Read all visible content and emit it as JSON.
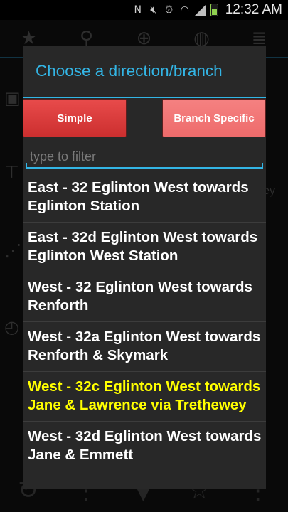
{
  "status_bar": {
    "time": "12:32 AM",
    "icons": [
      "nfc-icon",
      "mute-icon",
      "alarm-icon",
      "wifi-icon",
      "signal-icon",
      "battery-icon"
    ]
  },
  "background": {
    "tabs": [
      "star-icon",
      "search-icon",
      "location-icon",
      "globe-icon",
      "list-icon"
    ],
    "side_icons": [
      "bus-icon",
      "stop-sign-icon",
      "route-icon",
      "clock-icon"
    ],
    "partial_text": "ey",
    "bottom_icons": [
      "refresh-icon",
      "more-vertical-icon",
      "arrow-down-icon",
      "star-outline-icon",
      "overflow-icon"
    ]
  },
  "dialog": {
    "title": "Choose a direction/branch",
    "buttons": {
      "simple": "Simple",
      "branch_specific": "Branch Specific"
    },
    "filter": {
      "placeholder": "type to filter",
      "value": ""
    },
    "items": [
      {
        "label": "East - 32 Eglinton West towards Eglinton Station",
        "highlighted": false
      },
      {
        "label": "East - 32d Eglinton West towards Eglinton West Station",
        "highlighted": false
      },
      {
        "label": "West - 32 Eglinton West towards Renforth",
        "highlighted": false
      },
      {
        "label": "West - 32a Eglinton West towards Renforth & Skymark",
        "highlighted": false
      },
      {
        "label": "West - 32c Eglinton West towards Jane & Lawrence via Trethewey",
        "highlighted": true
      },
      {
        "label": "West - 32d Eglinton West towards Jane & Emmett",
        "highlighted": false
      }
    ],
    "colors": {
      "accent": "#33b5e5",
      "highlight": "#ffff00",
      "button_simple": "#d93a3a",
      "button_branch": "#f07676"
    }
  }
}
